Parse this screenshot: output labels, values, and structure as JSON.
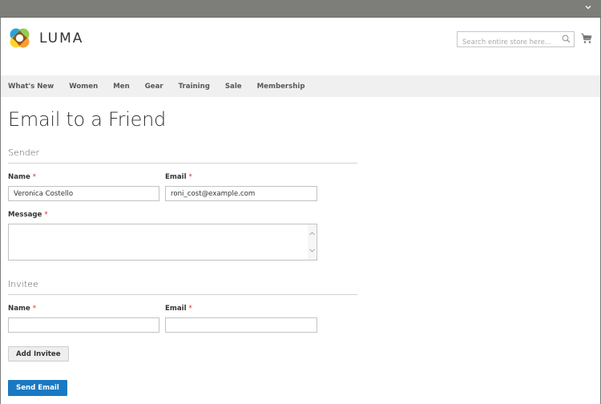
{
  "store": {
    "brand": "LUMA",
    "search_placeholder": "Search entire store here...",
    "logo_colors": [
      "#1d9fd9",
      "#8cc63f",
      "#f7941d",
      "#fbd116"
    ]
  },
  "nav": {
    "items": [
      {
        "label": "What's New"
      },
      {
        "label": "Women"
      },
      {
        "label": "Men"
      },
      {
        "label": "Gear"
      },
      {
        "label": "Training"
      },
      {
        "label": "Sale"
      },
      {
        "label": "Membership"
      }
    ]
  },
  "page": {
    "title": "Email to a Friend"
  },
  "sender": {
    "legend": "Sender",
    "name_label": "Name",
    "name_value": "Veronica Costello",
    "email_label": "Email",
    "email_value": "roni_cost@example.com",
    "message_label": "Message",
    "message_value": "",
    "required_mark": "*"
  },
  "invitee": {
    "legend": "Invitee",
    "name_label": "Name",
    "name_value": "",
    "email_label": "Email",
    "email_value": "",
    "required_mark": "*"
  },
  "actions": {
    "add_invitee": "Add Invitee",
    "send_email": "Send Email"
  },
  "colors": {
    "primary": "#1979c3",
    "required": "#e02b27",
    "nav_bg": "#f0f0f0"
  }
}
